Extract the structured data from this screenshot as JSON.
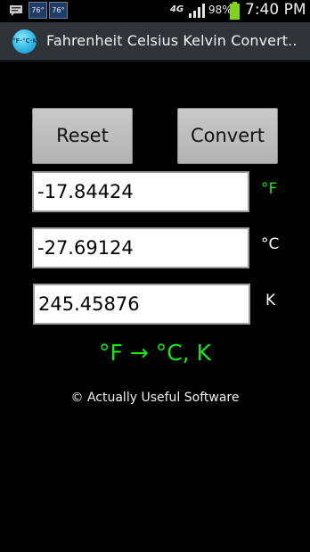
{
  "status_bar": {
    "icons": [
      "talk-icon",
      "temperature-icon",
      "temperature-icon",
      "signal-icon",
      "battery-icon"
    ],
    "temp_1": "76°",
    "temp_2": "76°",
    "network": "4G",
    "battery_percent": "98%",
    "time": "7:40 PM",
    "battery_color": "#7fd320"
  },
  "action_bar": {
    "app_icon_text": "°F·°C·K",
    "title": "Fahrenheit Celsius Kelvin Convert.."
  },
  "buttons": {
    "reset_label": "Reset",
    "convert_label": "Convert"
  },
  "fields": {
    "fahrenheit_value": "-17.84424",
    "celsius_value": "-27.69124",
    "kelvin_value": "245.45876"
  },
  "units": {
    "fahrenheit": "°F",
    "celsius": "°C",
    "kelvin": "K"
  },
  "mode_label": "°F → °C, K",
  "copyright": "© Actually Useful Software",
  "colors": {
    "accent_green": "#19e619",
    "action_bar": "#2f3439",
    "button": "#bfbfbf",
    "background": "#000000"
  }
}
